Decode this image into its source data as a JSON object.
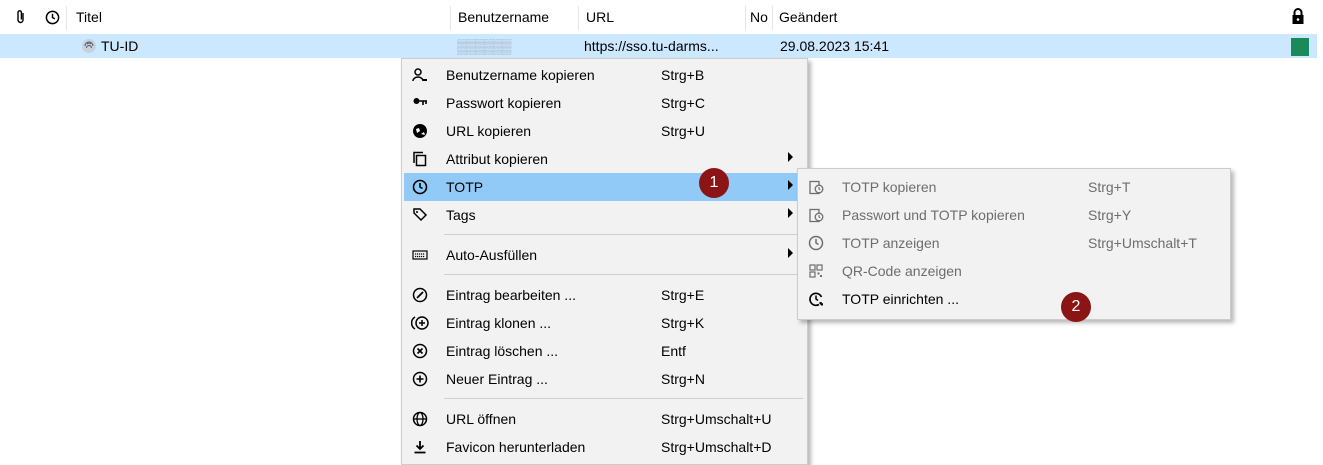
{
  "header": {
    "col_title": "Titel",
    "col_username": "Benutzername",
    "col_url": "URL",
    "col_notes": "No",
    "col_modified": "Geändert",
    "icons": [
      "paperclip-icon",
      "clock-icon",
      "lock-icon"
    ]
  },
  "entry": {
    "title": "TU-ID",
    "username_masked": "▒▒▒▒▒▒",
    "url": "https://sso.tu-darms...",
    "modified": "29.08.2023 15:41",
    "status_color": "#1a8a5a"
  },
  "context_menu": {
    "items": [
      {
        "icon": "user-icon",
        "label": "Benutzername kopieren",
        "shortcut": "Strg+B"
      },
      {
        "icon": "key-icon",
        "label": "Passwort kopieren",
        "shortcut": "Strg+C"
      },
      {
        "icon": "globe-link-icon",
        "label": "URL kopieren",
        "shortcut": "Strg+U"
      },
      {
        "icon": "copy-icon",
        "label": "Attribut kopieren",
        "shortcut": "",
        "submenu": true
      },
      {
        "icon": "clock-icon",
        "label": "TOTP",
        "shortcut": "",
        "submenu": true,
        "highlighted": true
      },
      {
        "icon": "tag-icon",
        "label": "Tags",
        "shortcut": "",
        "submenu": true
      },
      {
        "icon": "keyboard-icon",
        "label": "Auto-Ausfüllen",
        "shortcut": "",
        "submenu": true
      },
      {
        "icon": "edit-icon",
        "label": "Eintrag bearbeiten ...",
        "shortcut": "Strg+E"
      },
      {
        "icon": "clone-icon",
        "label": "Eintrag klonen ...",
        "shortcut": "Strg+K"
      },
      {
        "icon": "delete-icon",
        "label": "Eintrag löschen ...",
        "shortcut": "Entf"
      },
      {
        "icon": "add-icon",
        "label": "Neuer Eintrag ...",
        "shortcut": "Strg+N"
      },
      {
        "icon": "globe-icon",
        "label": "URL öffnen",
        "shortcut": "Strg+Umschalt+U"
      },
      {
        "icon": "download-icon",
        "label": "Favicon herunterladen",
        "shortcut": "Strg+Umschalt+D"
      }
    ]
  },
  "totp_submenu": {
    "items": [
      {
        "icon": "clipboard-clock-icon",
        "label": "TOTP kopieren",
        "shortcut": "Strg+T",
        "disabled": true
      },
      {
        "icon": "clipboard-clock-icon",
        "label": "Passwort und TOTP kopieren",
        "shortcut": "Strg+Y",
        "disabled": true
      },
      {
        "icon": "clock-icon",
        "label": "TOTP anzeigen",
        "shortcut": "Strg+Umschalt+T",
        "disabled": true
      },
      {
        "icon": "qr-code-icon",
        "label": "QR-Code anzeigen",
        "shortcut": "",
        "disabled": true
      },
      {
        "icon": "clock-setup-icon",
        "label": "TOTP einrichten ...",
        "shortcut": "",
        "disabled": false
      }
    ]
  },
  "badges": {
    "one": "1",
    "two": "2"
  },
  "colors": {
    "highlight": "#91c9f7",
    "row_selected": "#cce8ff",
    "badge": "#8b1414"
  }
}
